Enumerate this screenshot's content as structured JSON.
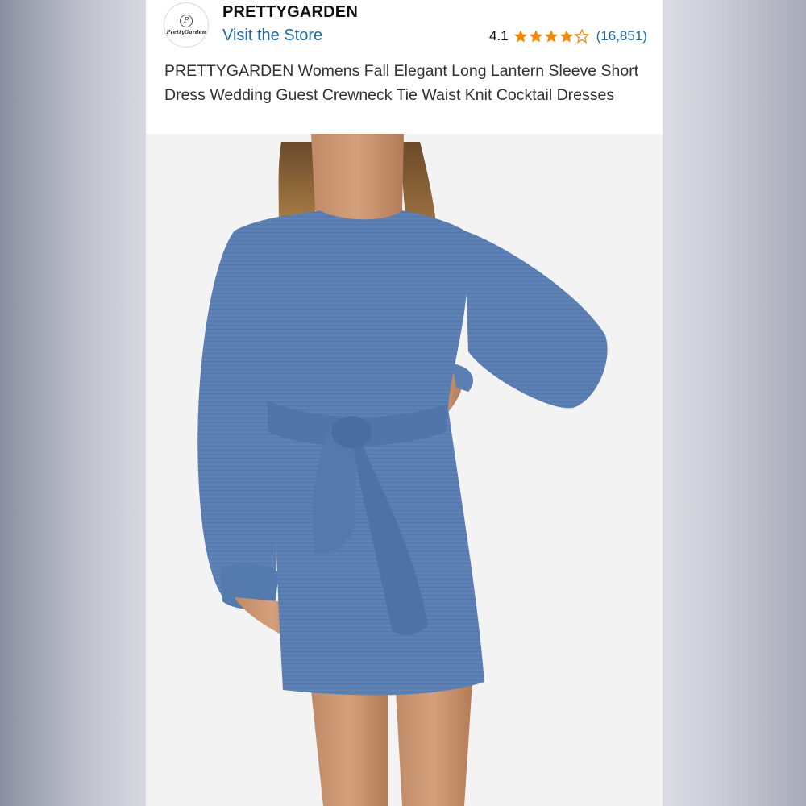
{
  "store": {
    "logo_text": "PrettyGarden",
    "name": "PRETTYGARDEN",
    "visit_link": "Visit the Store"
  },
  "rating": {
    "value": "4.1",
    "stars": 4.1,
    "count": "(16,851)",
    "star_color": "#f08804"
  },
  "product": {
    "title": "PRETTYGARDEN Womens Fall Elegant Long Lantern Sleeve Short Dress Wedding Guest Crewneck Tie Waist Knit Cocktail Dresses",
    "dress_color": "#5b7fb3"
  }
}
